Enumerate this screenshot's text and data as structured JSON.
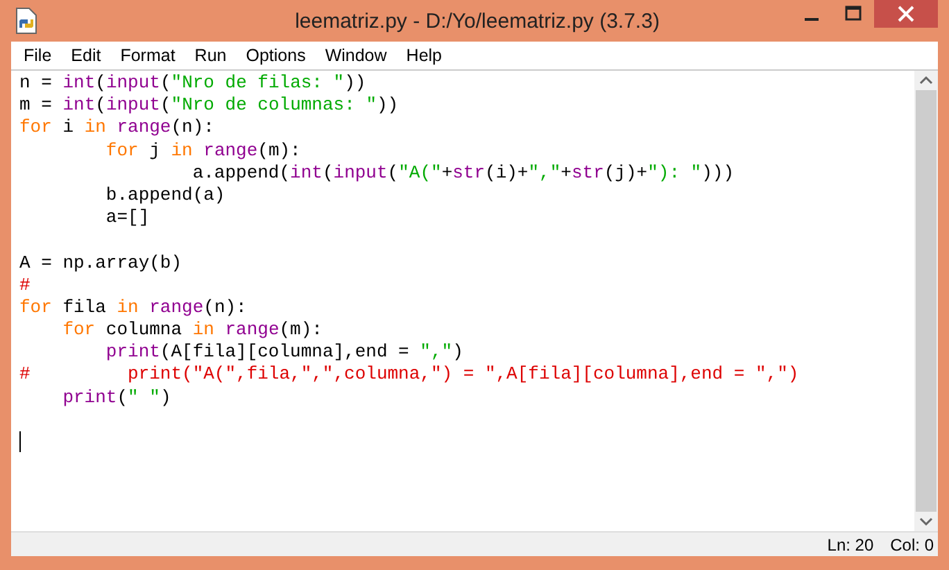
{
  "window": {
    "title": "leematriz.py - D:/Yo/leematriz.py (3.7.3)"
  },
  "menu": [
    "File",
    "Edit",
    "Format",
    "Run",
    "Options",
    "Window",
    "Help"
  ],
  "lines": [
    {
      "kind": "code",
      "tokens": [
        {
          "kind": "plain",
          "text": "n = "
        },
        {
          "kind": "builtin",
          "text": "int"
        },
        {
          "kind": "plain",
          "text": "("
        },
        {
          "kind": "builtin",
          "text": "input"
        },
        {
          "kind": "plain",
          "text": "("
        },
        {
          "kind": "string",
          "text": "\"Nro de filas: \""
        },
        {
          "kind": "plain",
          "text": "))"
        }
      ]
    },
    {
      "kind": "code",
      "tokens": [
        {
          "kind": "plain",
          "text": "m = "
        },
        {
          "kind": "builtin",
          "text": "int"
        },
        {
          "kind": "plain",
          "text": "("
        },
        {
          "kind": "builtin",
          "text": "input"
        },
        {
          "kind": "plain",
          "text": "("
        },
        {
          "kind": "string",
          "text": "\"Nro de columnas: \""
        },
        {
          "kind": "plain",
          "text": "))"
        }
      ]
    },
    {
      "kind": "code",
      "tokens": [
        {
          "kind": "keyword",
          "text": "for"
        },
        {
          "kind": "plain",
          "text": " i "
        },
        {
          "kind": "keyword",
          "text": "in"
        },
        {
          "kind": "builtin",
          "text": " range"
        },
        {
          "kind": "plain",
          "text": "(n):"
        }
      ]
    },
    {
      "kind": "code",
      "tokens": [
        {
          "kind": "keyword",
          "text": "        for"
        },
        {
          "kind": "plain",
          "text": " j "
        },
        {
          "kind": "keyword",
          "text": "in"
        },
        {
          "kind": "builtin",
          "text": " range"
        },
        {
          "kind": "plain",
          "text": "(m):"
        }
      ]
    },
    {
      "kind": "code",
      "tokens": [
        {
          "kind": "plain",
          "text": "                a.append("
        },
        {
          "kind": "builtin",
          "text": "int"
        },
        {
          "kind": "plain",
          "text": "("
        },
        {
          "kind": "builtin",
          "text": "input"
        },
        {
          "kind": "plain",
          "text": "("
        },
        {
          "kind": "string",
          "text": "\"A(\""
        },
        {
          "kind": "plain",
          "text": "+"
        },
        {
          "kind": "builtin",
          "text": "str"
        },
        {
          "kind": "plain",
          "text": "(i)+"
        },
        {
          "kind": "string",
          "text": "\",\""
        },
        {
          "kind": "plain",
          "text": "+"
        },
        {
          "kind": "builtin",
          "text": "str"
        },
        {
          "kind": "plain",
          "text": "(j)+"
        },
        {
          "kind": "string",
          "text": "\"): \""
        },
        {
          "kind": "plain",
          "text": ")))"
        }
      ]
    },
    {
      "kind": "code",
      "tokens": [
        {
          "kind": "plain",
          "text": "        b.append(a)"
        }
      ]
    },
    {
      "kind": "code",
      "tokens": [
        {
          "kind": "plain",
          "text": "        a=[]"
        }
      ]
    },
    {
      "kind": "blank"
    },
    {
      "kind": "code",
      "tokens": [
        {
          "kind": "plain",
          "text": "A = np.array(b)"
        }
      ]
    },
    {
      "kind": "code",
      "tokens": [
        {
          "kind": "comment",
          "text": "#"
        }
      ]
    },
    {
      "kind": "code",
      "tokens": [
        {
          "kind": "keyword",
          "text": "for"
        },
        {
          "kind": "plain",
          "text": " fila "
        },
        {
          "kind": "keyword",
          "text": "in"
        },
        {
          "kind": "builtin",
          "text": " range"
        },
        {
          "kind": "plain",
          "text": "(n):"
        }
      ]
    },
    {
      "kind": "code",
      "tokens": [
        {
          "kind": "keyword",
          "text": "    for"
        },
        {
          "kind": "plain",
          "text": " columna "
        },
        {
          "kind": "keyword",
          "text": "in"
        },
        {
          "kind": "builtin",
          "text": " range"
        },
        {
          "kind": "plain",
          "text": "(m):"
        }
      ]
    },
    {
      "kind": "code",
      "tokens": [
        {
          "kind": "builtin",
          "text": "        print"
        },
        {
          "kind": "plain",
          "text": "(A[fila][columna],end = "
        },
        {
          "kind": "string",
          "text": "\",\""
        },
        {
          "kind": "plain",
          "text": ")"
        }
      ]
    },
    {
      "kind": "code",
      "tokens": [
        {
          "kind": "comment",
          "text": "#         print(\"A(\",fila,\",\",columna,\") = \",A[fila][columna],end = \",\")"
        }
      ]
    },
    {
      "kind": "code",
      "tokens": [
        {
          "kind": "builtin",
          "text": "    print"
        },
        {
          "kind": "plain",
          "text": "("
        },
        {
          "kind": "string",
          "text": "\" \""
        },
        {
          "kind": "plain",
          "text": ")"
        }
      ]
    },
    {
      "kind": "blank"
    },
    {
      "kind": "cursor"
    }
  ],
  "status_bar": {
    "line": "Ln: 20",
    "column": "Col: 0"
  }
}
